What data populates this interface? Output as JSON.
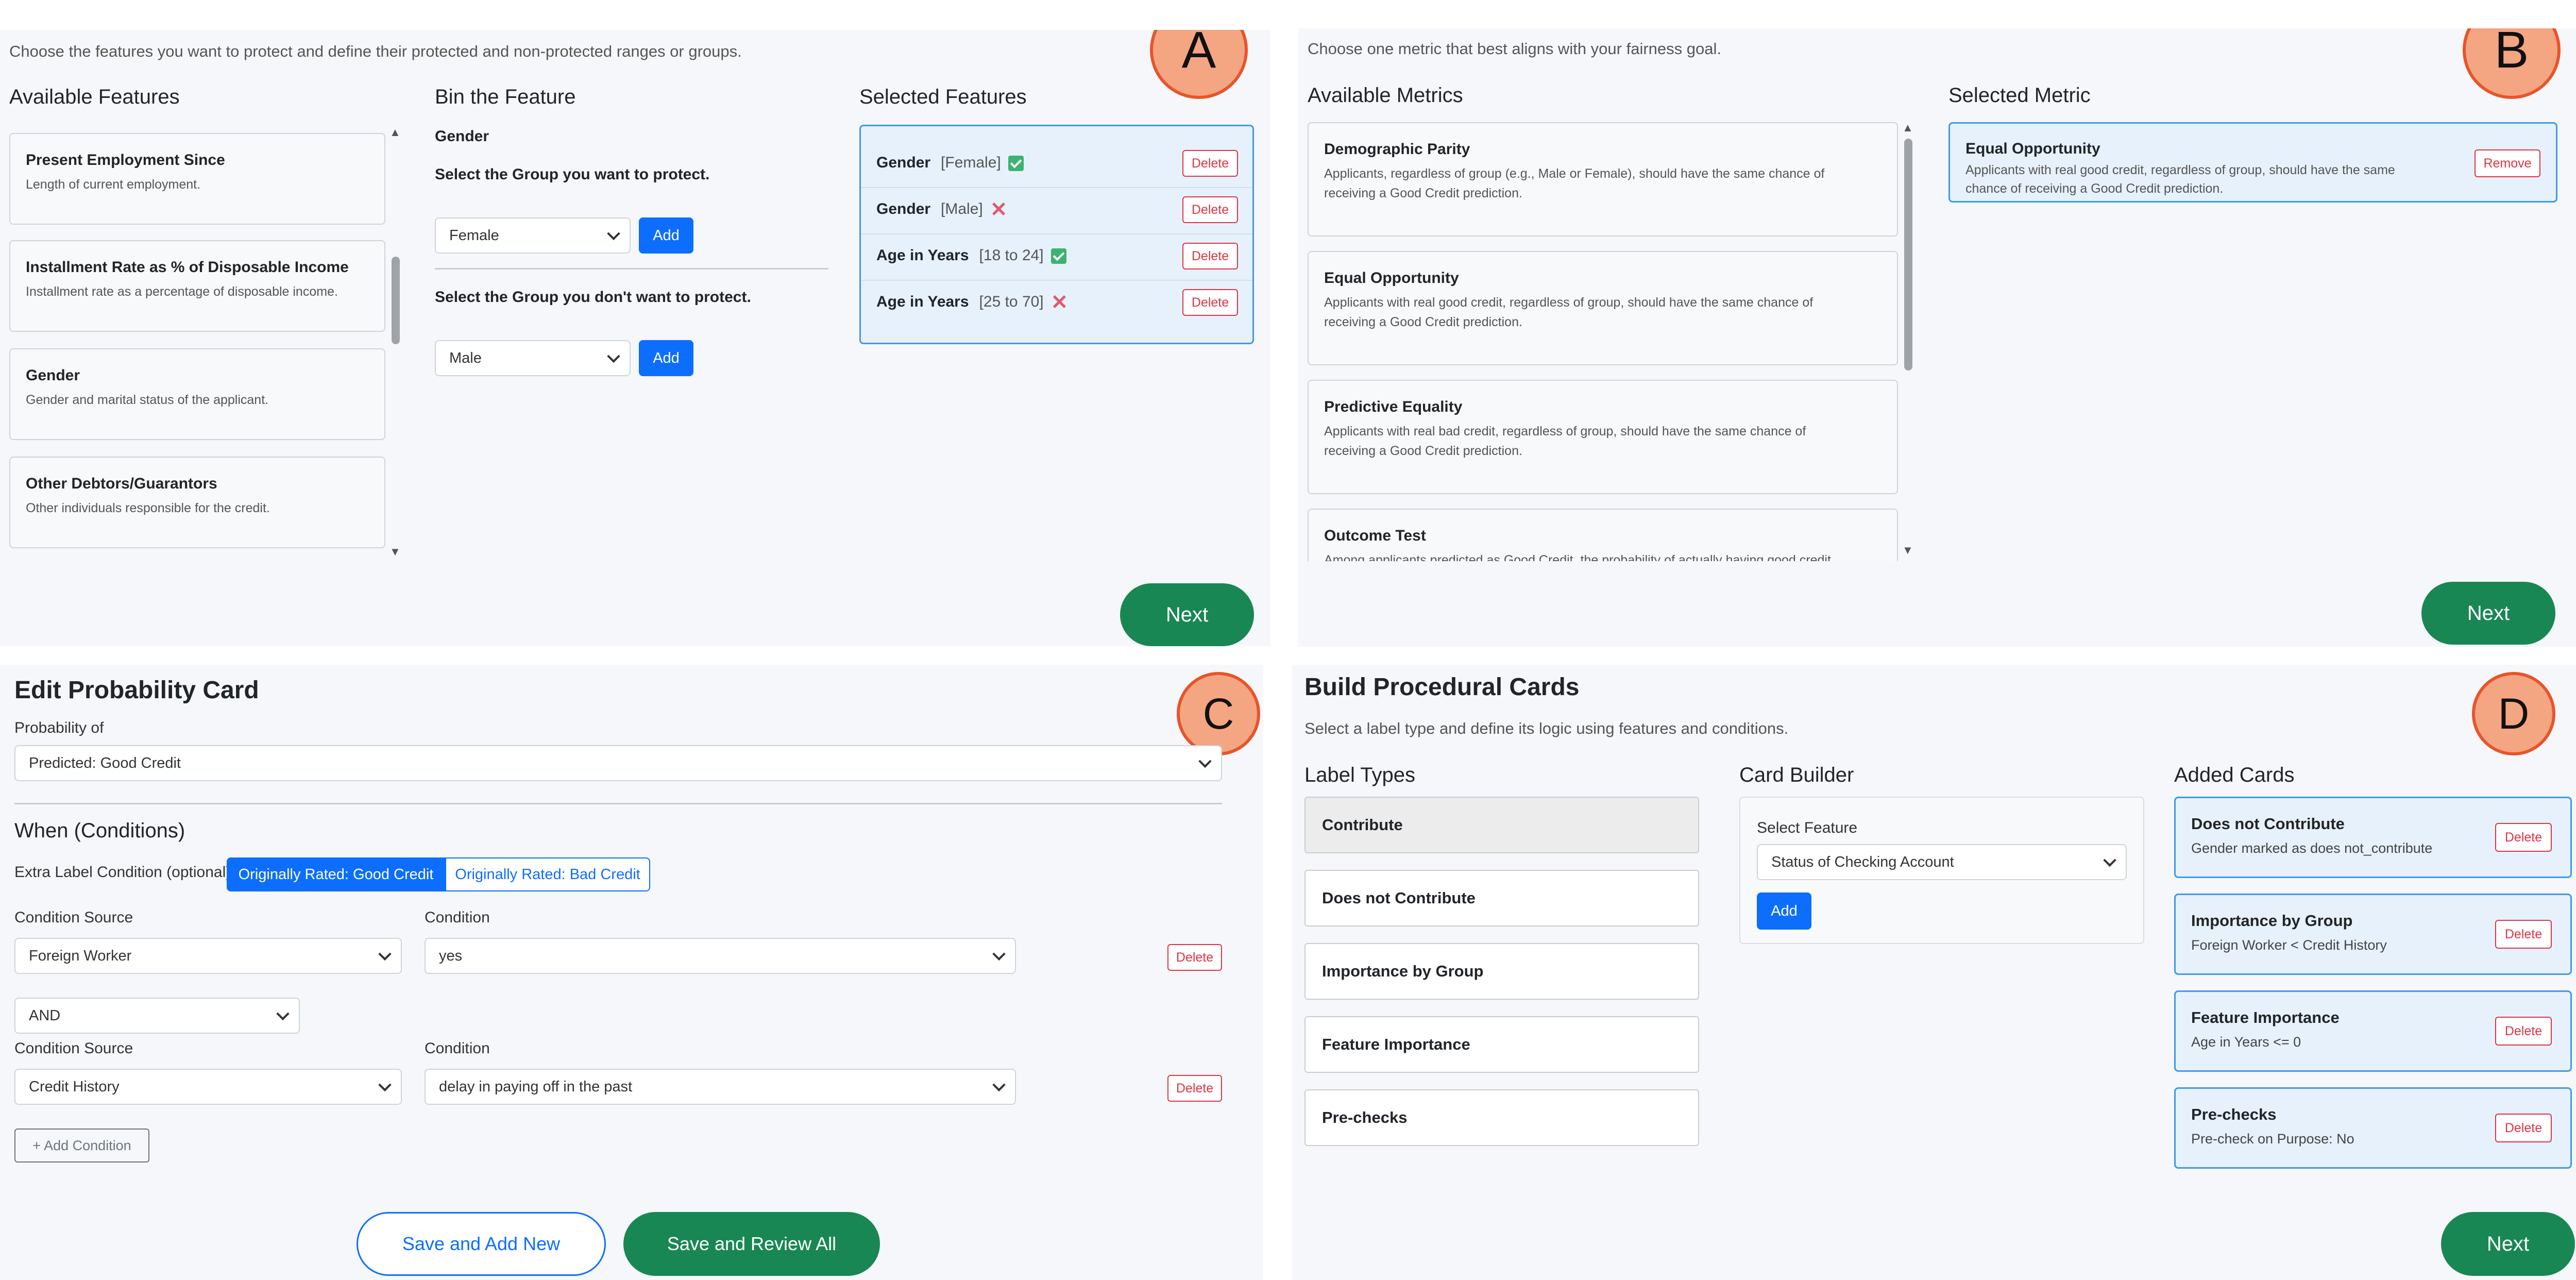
{
  "panel_a": {
    "badge": "A",
    "intro": "Choose the features you want to protect and define their protected and non-protected ranges or groups.",
    "available_heading": "Available Features",
    "features": [
      {
        "title": "Present Employment Since",
        "desc": "Length of current employment."
      },
      {
        "title": "Installment Rate as % of Disposable Income",
        "desc": "Installment rate as a percentage of disposable income."
      },
      {
        "title": "Gender",
        "desc": "Gender and marital status of the applicant."
      },
      {
        "title": "Other Debtors/Guarantors",
        "desc": "Other individuals responsible for the credit."
      }
    ],
    "bin_heading": "Bin the Feature",
    "bin_feature": "Gender",
    "protect_prompt": "Select the Group you want to protect.",
    "protect_value": "Female",
    "nonprotect_prompt": "Select the Group you don't want to protect.",
    "nonprotect_value": "Male",
    "add_label": "Add",
    "selected_heading": "Selected Features",
    "selected": [
      {
        "name": "Gender",
        "range": "[Female]",
        "protected": true
      },
      {
        "name": "Gender",
        "range": "[Male]",
        "protected": false
      },
      {
        "name": "Age in Years",
        "range": "[18 to 24]",
        "protected": true
      },
      {
        "name": "Age in Years",
        "range": "[25 to 70]",
        "protected": false
      }
    ],
    "delete_label": "Delete",
    "next_label": "Next"
  },
  "panel_b": {
    "badge": "B",
    "intro": "Choose one metric that best aligns with your fairness goal.",
    "available_heading": "Available Metrics",
    "metrics": [
      {
        "title": "Demographic Parity",
        "desc1": "Applicants, regardless of group (e.g., Male or Female), should have the same chance of",
        "desc2": "receiving a Good Credit prediction."
      },
      {
        "title": "Equal Opportunity",
        "desc1": "Applicants with real good credit, regardless of group, should have the same chance of",
        "desc2": "receiving a Good Credit prediction."
      },
      {
        "title": "Predictive Equality",
        "desc1": "Applicants with real bad credit, regardless of group, should have the same chance of",
        "desc2": "receiving a Good Credit prediction."
      },
      {
        "title": "Outcome Test",
        "desc1": "Among applicants predicted as Good Credit, the probability of actually having good credit",
        "desc2": ""
      }
    ],
    "selected_heading": "Selected Metric",
    "selected": {
      "title": "Equal Opportunity",
      "desc1": "Applicants with real good credit, regardless of group, should have the same",
      "desc2": "chance of receiving a Good Credit prediction."
    },
    "remove_label": "Remove",
    "next_label": "Next"
  },
  "panel_c": {
    "badge": "C",
    "title": "Edit Probability Card",
    "prob_label": "Probability of",
    "prob_value": "Predicted: Good Credit",
    "when_heading": "When (Conditions)",
    "extra_label": "Extra Label Condition (optional)",
    "seg_good": "Originally Rated: Good Credit",
    "seg_bad": "Originally Rated: Bad Credit",
    "source_label": "Condition Source",
    "condition_label": "Condition",
    "conditions": [
      {
        "source": "Foreign Worker",
        "condition": "yes"
      },
      {
        "source": "Credit History",
        "condition": "delay in paying off in the past"
      }
    ],
    "operator": "AND",
    "delete_label": "Delete",
    "add_condition": "+ Add Condition",
    "save_add": "Save and Add New",
    "save_review": "Save and Review All"
  },
  "panel_d": {
    "badge": "D",
    "title": "Build Procedural Cards",
    "intro": "Select a label type and define its logic using features and conditions.",
    "label_types_heading": "Label Types",
    "label_types": [
      "Contribute",
      "Does not Contribute",
      "Importance by Group",
      "Feature Importance",
      "Pre-checks"
    ],
    "builder_heading": "Card Builder",
    "select_feature_label": "Select Feature",
    "feature_value": "Status of Checking Account",
    "add_label": "Add",
    "added_heading": "Added Cards",
    "added_cards": [
      {
        "title": "Does not Contribute",
        "desc": "Gender marked as does not_contribute"
      },
      {
        "title": "Importance by Group",
        "desc": "Foreign Worker < Credit History"
      },
      {
        "title": "Feature Importance",
        "desc": "Age in Years <= 0"
      },
      {
        "title": "Pre-checks",
        "desc": "Pre-check on Purpose: No"
      }
    ],
    "delete_label": "Delete",
    "next_label": "Next"
  },
  "colors": {
    "primary": "#0d6efd",
    "success": "#198754",
    "danger": "#dc3545",
    "badge": "#f4a582"
  }
}
